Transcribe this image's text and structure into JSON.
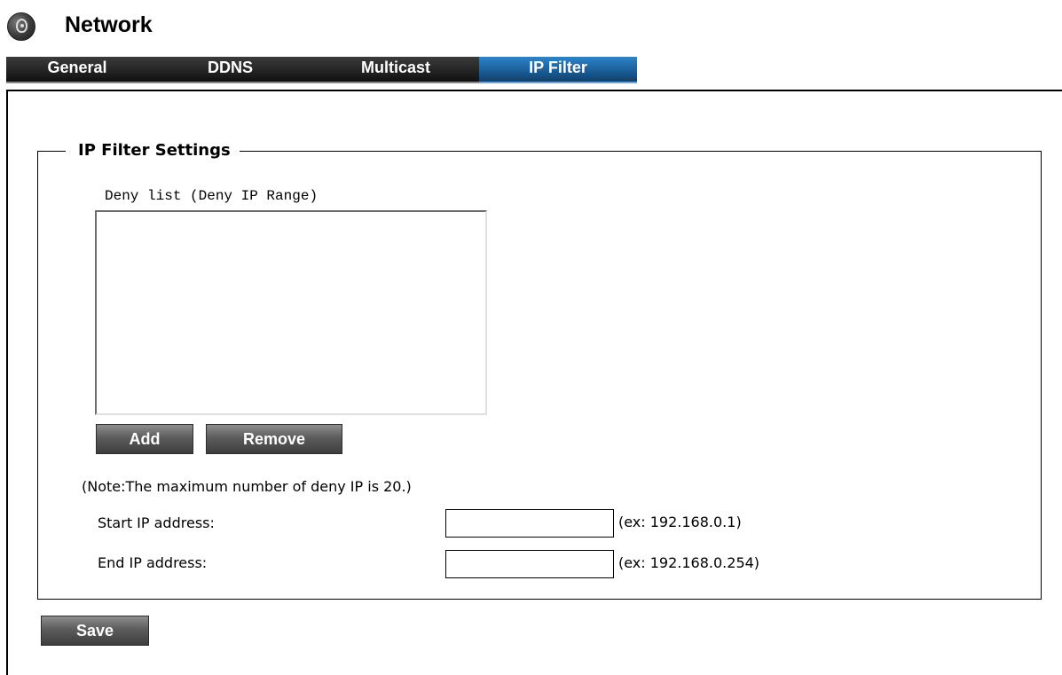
{
  "header": {
    "logo_icon": "camera-logo-icon",
    "title": "Network"
  },
  "tabs": [
    {
      "label": "General",
      "active": false
    },
    {
      "label": "DDNS",
      "active": false
    },
    {
      "label": "Multicast",
      "active": false
    },
    {
      "label": "IP Filter",
      "active": true
    }
  ],
  "ip_filter": {
    "legend": "IP Filter Settings",
    "deny_list_label": "Deny list (Deny IP Range)",
    "deny_list_items": [],
    "add_label": "Add",
    "remove_label": "Remove",
    "note": "(Note:The maximum number of deny IP is 20.)",
    "start_ip_label": "Start IP address:",
    "start_ip_value": "",
    "start_ip_example": "(ex: 192.168.0.1)",
    "end_ip_label": "End IP address:",
    "end_ip_value": "",
    "end_ip_example": "(ex: 192.168.0.254)"
  },
  "footer": {
    "save_label": "Save"
  },
  "colors": {
    "tab_background": "#242424",
    "tab_active_background": "#1b5e99",
    "button_background": "#5c5c5c",
    "text": "#000000"
  }
}
